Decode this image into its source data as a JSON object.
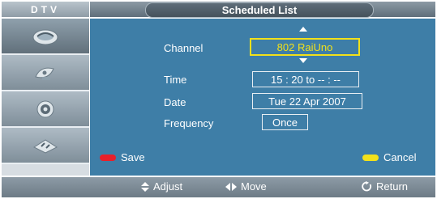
{
  "header": {
    "mode_label": "DTV",
    "title": "Scheduled List"
  },
  "sidebar": {
    "items": [
      {
        "icon": "picture-icon",
        "active": true
      },
      {
        "icon": "satellite-dish-icon",
        "active": false
      },
      {
        "icon": "settings-gear-icon",
        "active": false
      },
      {
        "icon": "input-source-icon",
        "active": false
      }
    ]
  },
  "form": {
    "channel_label": "Channel",
    "channel_value": "802 RaiUno",
    "time_label": "Time",
    "time_value": "15 : 20 to -- : --",
    "date_label": "Date",
    "date_value": "Tue 22 Apr 2007",
    "frequency_label": "Frequency",
    "frequency_value": "Once"
  },
  "actions": {
    "save_label": "Save",
    "save_color": "#e8202a",
    "cancel_label": "Cancel",
    "cancel_color": "#f2e11a"
  },
  "footer": {
    "adjust_label": "Adjust",
    "move_label": "Move",
    "return_label": "Return"
  },
  "colors": {
    "panel": "#3e7ea7",
    "highlight": "#f2e11a"
  }
}
